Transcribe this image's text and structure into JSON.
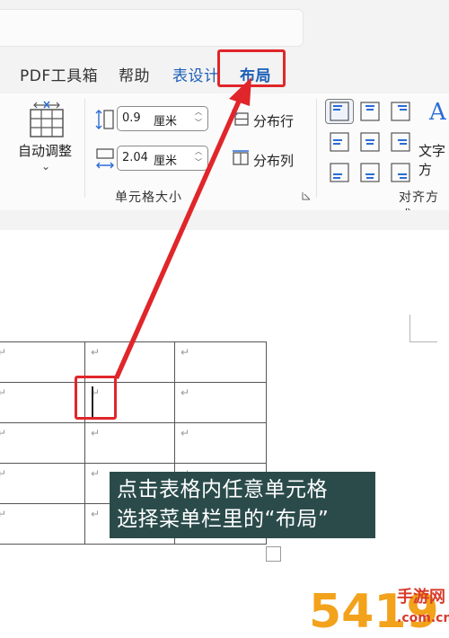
{
  "ribbon_tabs": {
    "pdf_tools": "PDF工具箱",
    "help": "帮助",
    "table_design": "表设计",
    "layout": "布局"
  },
  "cell_size_group": {
    "autofit_label": "自动调整",
    "row_height": {
      "value": "0.9",
      "unit": "厘米"
    },
    "column_width": {
      "value": "2.04",
      "unit": "厘米"
    },
    "distribute_rows": "分布行",
    "distribute_columns": "分布列",
    "group_label": "单元格大小"
  },
  "alignment_group": {
    "text_direction_label": "文字方",
    "text_direction_icon_glyph": "A",
    "group_label": "对齐方式"
  },
  "table": {
    "rows": 5,
    "columns": 3,
    "cell_mark": "↵"
  },
  "caption": {
    "line1": "点击表格内任意单元格",
    "line2": "选择菜单栏里的“布局”"
  },
  "watermark": {
    "digits": "5419",
    "site_name": "手游网",
    "domain": ".com.cn"
  },
  "colors": {
    "accent_blue": "#2b6cd6",
    "highlight_red": "#e0262a",
    "caption_bg": "#2b4b4b"
  }
}
